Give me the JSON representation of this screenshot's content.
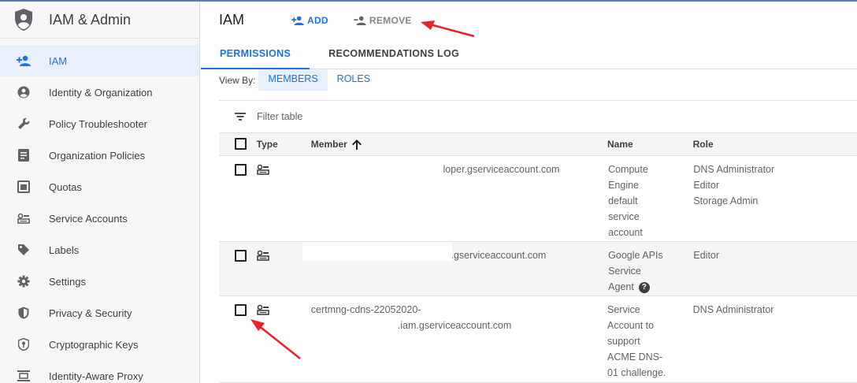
{
  "app": {
    "title": "IAM & Admin",
    "logo_icon": "shield-person-icon"
  },
  "sidebar": {
    "items": [
      {
        "label": "IAM",
        "icon": "person-add-icon",
        "active": true
      },
      {
        "label": "Identity & Organization",
        "icon": "account-circle-icon"
      },
      {
        "label": "Policy Troubleshooter",
        "icon": "wrench-icon"
      },
      {
        "label": "Organization Policies",
        "icon": "document-list-icon"
      },
      {
        "label": "Quotas",
        "icon": "quota-calendar-icon"
      },
      {
        "label": "Service Accounts",
        "icon": "service-account-icon"
      },
      {
        "label": "Labels",
        "icon": "tag-icon"
      },
      {
        "label": "Settings",
        "icon": "gear-icon"
      },
      {
        "label": "Privacy & Security",
        "icon": "shield-icon"
      },
      {
        "label": "Cryptographic Keys",
        "icon": "key-shield-icon"
      },
      {
        "label": "Identity-Aware Proxy",
        "icon": "proxy-icon"
      }
    ]
  },
  "header": {
    "title": "IAM",
    "add_label": "ADD",
    "remove_label": "REMOVE"
  },
  "tabs": [
    {
      "label": "PERMISSIONS",
      "active": true
    },
    {
      "label": "RECOMMENDATIONS LOG",
      "active": false
    }
  ],
  "view_by": {
    "label": "View By:",
    "options": [
      {
        "label": "MEMBERS",
        "active": true
      },
      {
        "label": "ROLES",
        "active": false
      }
    ]
  },
  "filter": {
    "placeholder": "Filter table"
  },
  "table": {
    "columns": {
      "type": "Type",
      "member": "Member",
      "name": "Name",
      "role": "Role"
    },
    "rows": [
      {
        "member_lines": [
          "loper.gserviceaccount.com"
        ],
        "name_lines": [
          "Compute",
          "Engine",
          "default",
          "service",
          "account"
        ],
        "roles": [
          "DNS Administrator",
          "Editor",
          "Storage Admin"
        ]
      },
      {
        "member_lines": [
          ".gserviceaccount.com"
        ],
        "name_lines": [
          "Google APIs",
          "Service",
          "Agent"
        ],
        "name_help": "?",
        "roles": [
          "Editor"
        ]
      },
      {
        "member_lines": [
          "certmng-cdns-22052020-",
          ".iam.gserviceaccount.com"
        ],
        "name_lines": [
          "Service",
          "Account to",
          "support",
          "ACME DNS-",
          "01 challenge."
        ],
        "roles": [
          "DNS Administrator"
        ]
      }
    ]
  },
  "colors": {
    "accent": "#1a73e8",
    "annotation_arrow": "#e8212b"
  }
}
